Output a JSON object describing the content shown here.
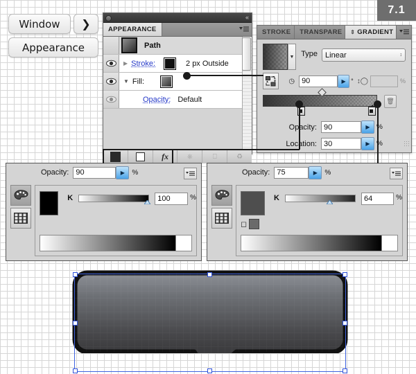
{
  "version_badge": "7.1",
  "menu_path": {
    "window_label": "Window",
    "arrow_glyph": "❯",
    "appearance_label": "Appearance"
  },
  "appearance_panel": {
    "tab_label": "APPEARANCE",
    "menu_icon": "panel-menu-icon",
    "collapse_icon": "«",
    "rows": [
      {
        "name": "Path",
        "type": "object-title",
        "thumb": "gradient-thumb"
      },
      {
        "name": "Stroke:",
        "value": "2 px  Outside",
        "type": "stroke",
        "expander": "▶",
        "swatch": "#111111"
      },
      {
        "name": "Fill:",
        "value": "",
        "type": "fill",
        "expander": "▼",
        "swatch": "gradient"
      },
      {
        "name": "Opacity:",
        "value": "Default",
        "type": "opacity"
      }
    ],
    "footer_buttons": [
      "new-stroke-button",
      "new-fill-button",
      "add-effect-button",
      "clear-appearance-button",
      "duplicate-item-button",
      "delete-item-button"
    ],
    "footer_glyphs": [
      "■",
      "□",
      "fx",
      "◴",
      "⬜",
      "♻"
    ]
  },
  "gradient_panel": {
    "tabs": [
      {
        "label": "STROKE",
        "active": false
      },
      {
        "label": "TRANSPARE",
        "active": false
      },
      {
        "label": "GRADIENT",
        "active": true
      }
    ],
    "menu_icon": "panel-menu-icon",
    "collapse_icon": "«",
    "type_label": "Type",
    "type_value": "Linear",
    "angle_value": "90",
    "angle_unit": "°",
    "aspect_value": "",
    "aspect_unit": "%",
    "opacity_label": "Opacity:",
    "opacity_value": "90",
    "opacity_unit": "%",
    "location_label": "Location:",
    "location_value": "30",
    "location_unit": "%",
    "reverse_icon": "reverse-gradient-icon",
    "delete_stop_icon": "trash-icon"
  },
  "color_panel_left": {
    "name": "color-panel-left",
    "opacity_label": "Opacity:",
    "opacity_value": "90",
    "opacity_unit": "%",
    "channel_label": "K",
    "channel_value": "100",
    "channel_unit": "%",
    "swatch_color": "#000000",
    "slider_percent": 100,
    "tool_icons": [
      "color-palette-icon",
      "swatches-grid-icon"
    ],
    "menu_icon": "panel-menu-icon"
  },
  "color_panel_right": {
    "name": "color-panel-right",
    "opacity_label": "Opacity:",
    "opacity_value": "75",
    "opacity_unit": "%",
    "channel_label": "K",
    "channel_value": "64",
    "channel_unit": "%",
    "swatch_color": "#4e4e4e",
    "slider_percent": 64,
    "tool_icons": [
      "color-palette-icon",
      "swatches-grid-icon"
    ],
    "extra_icons": [
      "none-color-icon",
      "registration-swatch-icon"
    ],
    "menu_icon": "panel-menu-icon"
  },
  "artwork": {
    "name": "speech-bubble-shape",
    "stroke_color": "#111111",
    "fill_top": "#8a8d92",
    "fill_bottom": "#2b2b2d",
    "selection_color": "#3f63e0"
  }
}
